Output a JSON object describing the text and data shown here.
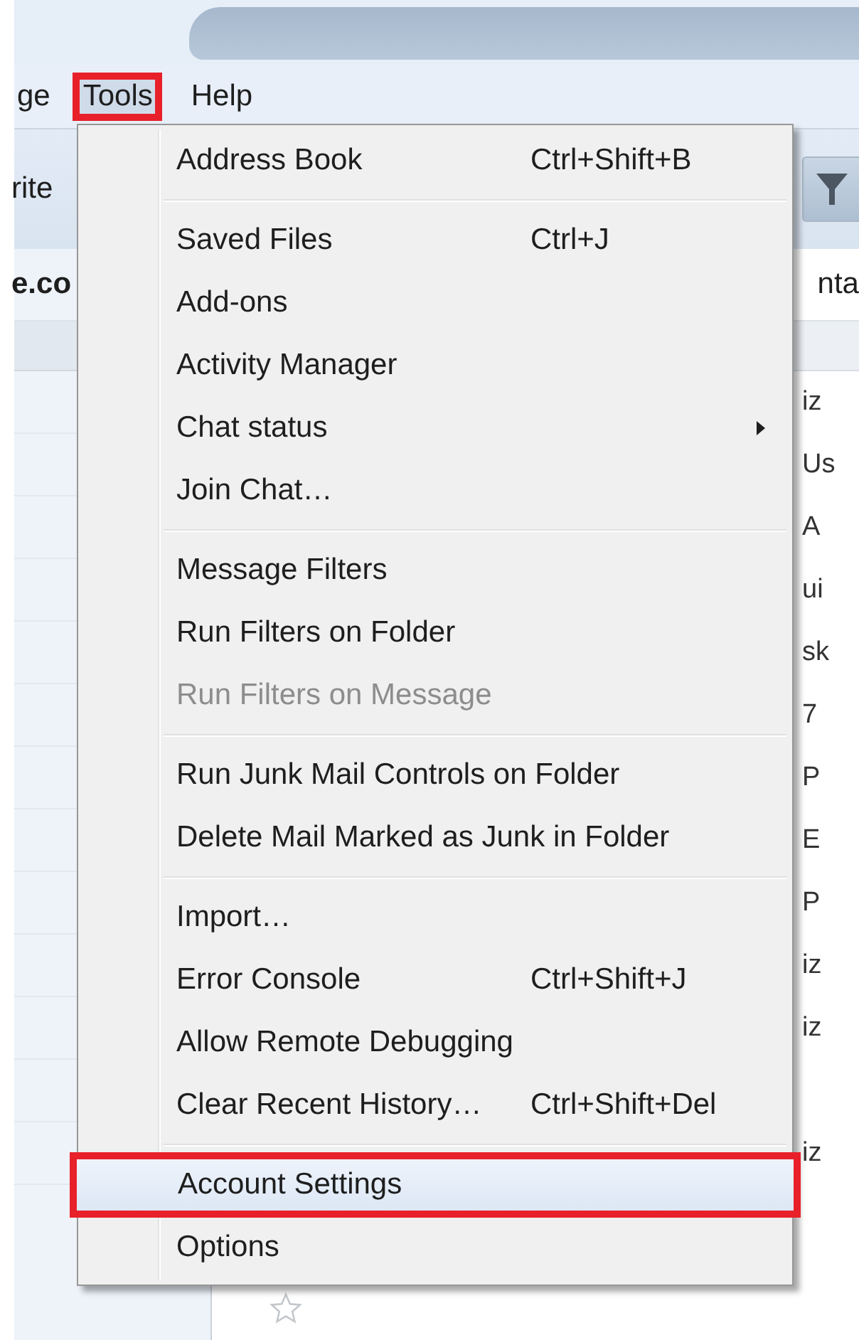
{
  "menubar": [
    {
      "label": "ge",
      "selected": false,
      "annotated": false
    },
    {
      "label": "Tools",
      "selected": true,
      "annotated": true
    },
    {
      "label": "Help",
      "selected": false,
      "annotated": false
    }
  ],
  "toolbar": {
    "button_text": "rite"
  },
  "list_header": {
    "left_text": "e.co",
    "right_text": "nta"
  },
  "message_rows": [
    {
      "fragment": "iz"
    },
    {
      "fragment": "Us"
    },
    {
      "fragment": "A"
    },
    {
      "fragment": "ui"
    },
    {
      "fragment": "sk"
    },
    {
      "fragment": "7"
    },
    {
      "fragment": "P"
    },
    {
      "fragment": "E"
    },
    {
      "fragment": "P"
    },
    {
      "fragment": "iz"
    },
    {
      "fragment": "iz"
    },
    {},
    {
      "fragment": "iz"
    }
  ],
  "menu": {
    "items": [
      {
        "kind": "item",
        "label": "Address Book",
        "shortcut": "Ctrl+Shift+B",
        "submenu": false,
        "disabled": false,
        "selected": false,
        "annotated": false
      },
      {
        "kind": "separator"
      },
      {
        "kind": "item",
        "label": "Saved Files",
        "shortcut": "Ctrl+J",
        "submenu": false,
        "disabled": false,
        "selected": false,
        "annotated": false
      },
      {
        "kind": "item",
        "label": "Add-ons",
        "submenu": false,
        "disabled": false,
        "selected": false,
        "annotated": false
      },
      {
        "kind": "item",
        "label": "Activity Manager",
        "submenu": false,
        "disabled": false,
        "selected": false,
        "annotated": false
      },
      {
        "kind": "item",
        "label": "Chat status",
        "submenu": true,
        "disabled": false,
        "selected": false,
        "annotated": false
      },
      {
        "kind": "item",
        "label": "Join Chat…",
        "submenu": false,
        "disabled": false,
        "selected": false,
        "annotated": false
      },
      {
        "kind": "separator"
      },
      {
        "kind": "item",
        "label": "Message Filters",
        "submenu": false,
        "disabled": false,
        "selected": false,
        "annotated": false
      },
      {
        "kind": "item",
        "label": "Run Filters on Folder",
        "submenu": false,
        "disabled": false,
        "selected": false,
        "annotated": false
      },
      {
        "kind": "item",
        "label": "Run Filters on Message",
        "submenu": false,
        "disabled": true,
        "selected": false,
        "annotated": false
      },
      {
        "kind": "separator"
      },
      {
        "kind": "item",
        "label": "Run Junk Mail Controls on Folder",
        "submenu": false,
        "disabled": false,
        "selected": false,
        "annotated": false
      },
      {
        "kind": "item",
        "label": "Delete Mail Marked as Junk in Folder",
        "submenu": false,
        "disabled": false,
        "selected": false,
        "annotated": false
      },
      {
        "kind": "separator"
      },
      {
        "kind": "item",
        "label": "Import…",
        "submenu": false,
        "disabled": false,
        "selected": false,
        "annotated": false
      },
      {
        "kind": "item",
        "label": "Error Console",
        "shortcut": "Ctrl+Shift+J",
        "submenu": false,
        "disabled": false,
        "selected": false,
        "annotated": false
      },
      {
        "kind": "item",
        "label": "Allow Remote Debugging",
        "submenu": false,
        "disabled": false,
        "selected": false,
        "annotated": false
      },
      {
        "kind": "item",
        "label": "Clear Recent History…",
        "shortcut": "Ctrl+Shift+Del",
        "submenu": false,
        "disabled": false,
        "selected": false,
        "annotated": false
      },
      {
        "kind": "separator"
      },
      {
        "kind": "item",
        "label": "Account Settings",
        "submenu": false,
        "disabled": false,
        "selected": true,
        "annotated": true
      },
      {
        "kind": "item",
        "label": "Options",
        "submenu": false,
        "disabled": false,
        "selected": false,
        "annotated": false
      }
    ]
  }
}
